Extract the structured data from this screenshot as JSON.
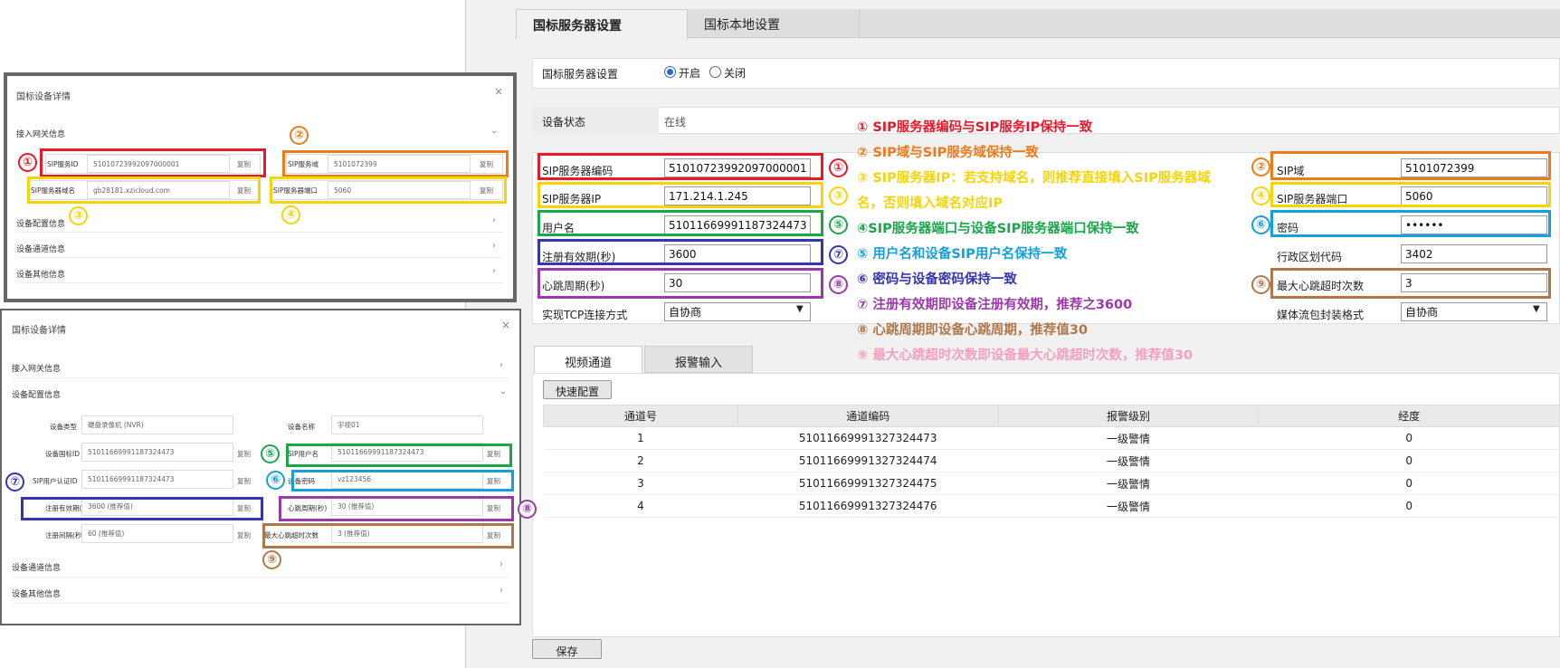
{
  "right": {
    "tabs": [
      "国标服务器设置",
      "国标本地设置"
    ],
    "server_label": "国标服务器设置",
    "radio_on": "开启",
    "radio_off": "关闭",
    "status_label": "设备状态",
    "status_value": "在线",
    "fields_left": [
      {
        "label": "SIP服务器编码",
        "value": "51010723992097000001"
      },
      {
        "label": "SIP服务器IP",
        "value": "171.214.1.245"
      },
      {
        "label": "用户名",
        "value": "51011669991187324473"
      },
      {
        "label": "注册有效期(秒)",
        "value": "3600"
      },
      {
        "label": "心跳周期(秒)",
        "value": "30"
      },
      {
        "label": "实现TCP连接方式",
        "value": "自协商"
      }
    ],
    "fields_right": [
      {
        "label": "SIP域",
        "value": "5101072399"
      },
      {
        "label": "SIP服务器端口",
        "value": "5060"
      },
      {
        "label": "密码",
        "value": "••••••"
      },
      {
        "label": "行政区划代码",
        "value": "3402"
      },
      {
        "label": "最大心跳超时次数",
        "value": "3"
      },
      {
        "label": "媒体流包封装格式",
        "value": "自协商"
      }
    ],
    "subtabs": [
      "视频通道",
      "报警输入"
    ],
    "quick_config": "快速配置",
    "columns": [
      "通道号",
      "通道编码",
      "报警级别",
      "经度"
    ],
    "rows": [
      [
        "1",
        "51011669991327324473",
        "一级警情",
        "0"
      ],
      [
        "2",
        "51011669991327324474",
        "一级警情",
        "0"
      ],
      [
        "3",
        "51011669991327324475",
        "一级警情",
        "0"
      ],
      [
        "4",
        "51011669991327324476",
        "一级警情",
        "0"
      ]
    ],
    "save": "保存"
  },
  "notes": [
    {
      "text": "① SIP服务器编码与SIP服务IP保持一致",
      "color": "#e8192c"
    },
    {
      "text": "② SIP域与SIP服务域保持一致",
      "color": "#f07a1a"
    },
    {
      "text": "③ SIP服务器IP：若支持域名，则推荐直接填入SIP服务器域",
      "color": "#f5d40a"
    },
    {
      "text": "名，否则填入域名对应IP",
      "color": "#f5d40a"
    },
    {
      "text": "④SIP服务器端口与设备SIP服务器端口保持一致",
      "color": "#1aa64a"
    },
    {
      "text": "⑤ 用户名和设备SIP用户名保持一致",
      "color": "#14a0dc"
    },
    {
      "text": "⑥ 密码与设备密码保持一致",
      "color": "#3434b4"
    },
    {
      "text": "⑦ 注册有效期即设备注册有效期，推荐之3600",
      "color": "#9a3aa8"
    },
    {
      "text": "⑧ 心跳周期即设备心跳周期，推荐值30",
      "color": "#b0784a"
    },
    {
      "text": "⑨ 最大心跳超时次数即设备最大心跳超时次数，推荐值30",
      "color": "#f5a0c0"
    }
  ],
  "circles": [
    "①",
    "②",
    "③",
    "④",
    "⑤",
    "⑥",
    "⑦",
    "⑧",
    "⑨"
  ],
  "dlg1": {
    "title": "国标设备详情",
    "close": "×",
    "section": "接入网关信息",
    "f1_label": "SIP服务ID",
    "f1_value": "51010723992097000001",
    "f2_label": "SIP服务域",
    "f2_value": "5101072399",
    "f3_label": "SIP服务器域名",
    "f3_value": "gb28181.xzicloud.com",
    "f4_label": "SIP服务器端口",
    "f4_value": "5060",
    "copy": "复制",
    "sections": [
      "设备配置信息",
      "设备通道信息",
      "设备其他信息"
    ]
  },
  "dlg2": {
    "title": "国标设备详情",
    "close": "×",
    "sections_top": [
      "接入网关信息",
      "设备配置信息"
    ],
    "rows": [
      {
        "l1": "设备类型",
        "v1": "硬盘录像机 (NVR)",
        "l2": "设备名称",
        "v2": "宇视01"
      },
      {
        "l1": "设备国标ID",
        "v1": "51011669991187324473",
        "l2": "SIP用户名",
        "v2": "51011669991187324473"
      },
      {
        "l1": "SIP用户认证ID",
        "v1": "51011669991187324473",
        "l2": "设备密码",
        "v2": "vz123456"
      },
      {
        "l1": "注册有效期(秒)",
        "v1": "3600 (推荐值)",
        "l2": "心跳周期(秒)",
        "v2": "30 (推荐值)"
      },
      {
        "l1": "注册间隔(秒)",
        "v1": "60 (推荐值)",
        "l2": "最大心跳超时次数",
        "v2": "3 (推荐值)"
      }
    ],
    "copy": "复制",
    "sections_bottom": [
      "设备通道信息",
      "设备其他信息"
    ]
  }
}
